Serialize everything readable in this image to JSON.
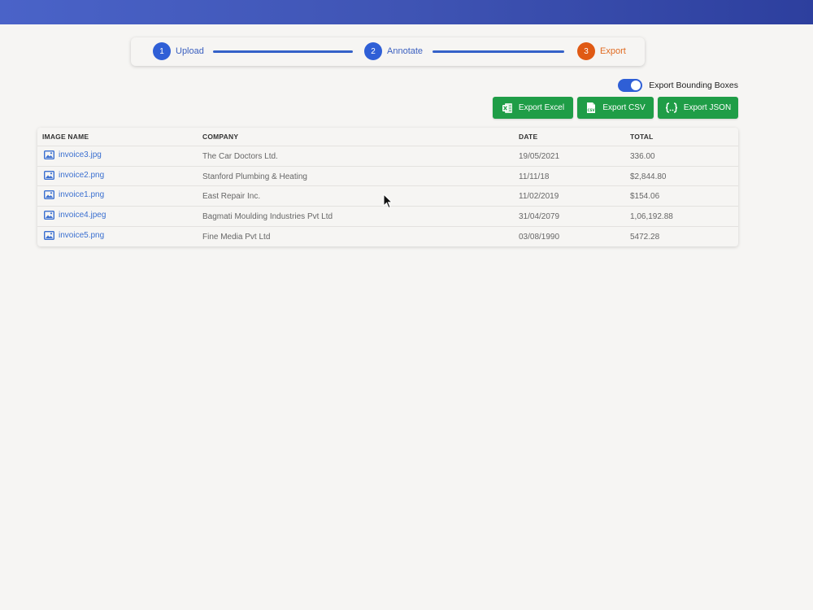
{
  "stepper": {
    "steps": [
      {
        "number": "1",
        "label": "Upload"
      },
      {
        "number": "2",
        "label": "Annotate"
      },
      {
        "number": "3",
        "label": "Export"
      }
    ]
  },
  "toggle": {
    "label": "Export Bounding Boxes",
    "on": true
  },
  "buttons": {
    "excel": {
      "label": "Export Excel",
      "icon": "excel-icon"
    },
    "csv": {
      "label": "Export CSV",
      "icon": "csv-file-icon"
    },
    "json": {
      "label": "Export JSON",
      "icon": "json-braces-icon"
    }
  },
  "table": {
    "headers": [
      "IMAGE NAME",
      "COMPANY",
      "DATE",
      "TOTAL"
    ],
    "rows": [
      {
        "image": "invoice3.jpg",
        "company": "The Car Doctors Ltd.",
        "date": "19/05/2021",
        "total": "336.00"
      },
      {
        "image": "invoice2.png",
        "company": "Stanford Plumbing & Heating",
        "date": "11/11/18",
        "total": "$2,844.80"
      },
      {
        "image": "invoice1.png",
        "company": "East Repair Inc.",
        "date": "11/02/2019",
        "total": "$154.06"
      },
      {
        "image": "invoice4.jpeg",
        "company": "Bagmati Moulding Industries Pvt Ltd",
        "date": "31/04/2079",
        "total": "1,06,192.88"
      },
      {
        "image": "invoice5.png",
        "company": "Fine Media Pvt Ltd",
        "date": "03/08/1990",
        "total": "5472.28"
      }
    ]
  },
  "colors": {
    "primary": "#2f5fd6",
    "active_step": "#e05a14",
    "export_button": "#1f9d47",
    "link": "#3a6fd0"
  }
}
